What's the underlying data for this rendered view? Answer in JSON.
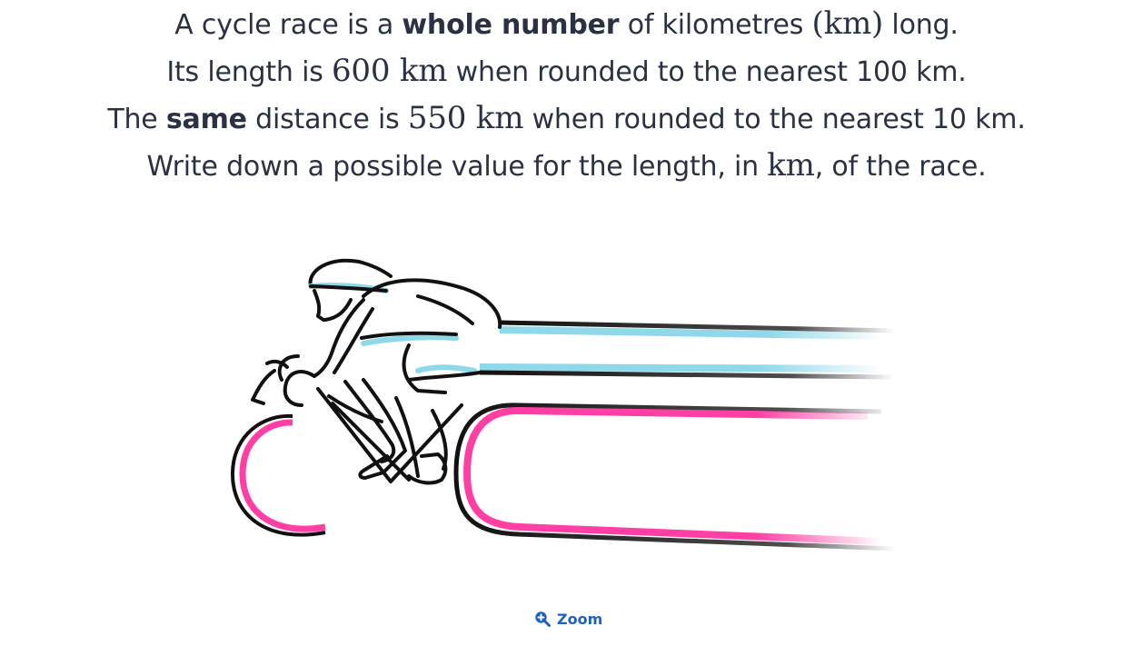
{
  "question": {
    "line1": {
      "a": "A cycle race is a ",
      "bold": "whole number",
      "b": " of kilometres ",
      "math": "(km)",
      "c": " long."
    },
    "line2": {
      "a": "Its length is ",
      "math": "600 km",
      "b": " when rounded to the nearest 100 km."
    },
    "line3": {
      "a": "The ",
      "bold": "same",
      "b": " distance is ",
      "math": "550 km",
      "c": " when rounded to the nearest 10 km."
    },
    "line4": {
      "a": "Write down a possible value for the length, in ",
      "math": "km",
      "b": ", of the race."
    }
  },
  "illustration": {
    "subject": "cyclist racing with speed lines",
    "colors": {
      "outline": "#111111",
      "blue": "#8fd8ea",
      "pink": "#ff3fa4"
    }
  },
  "zoom": {
    "label": "Zoom",
    "icon": "zoom-in-icon",
    "color": "#1e5fbf"
  }
}
